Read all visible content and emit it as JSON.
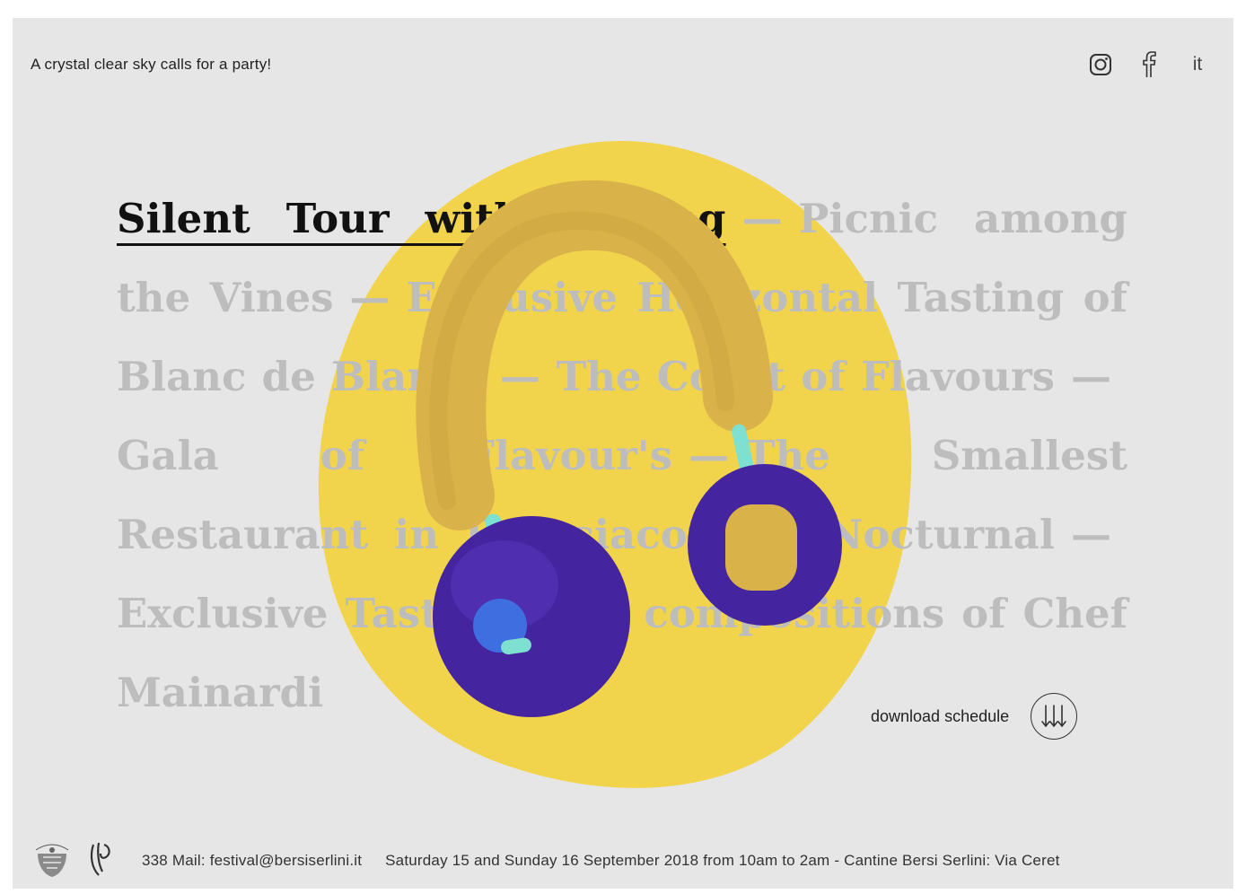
{
  "header": {
    "tagline": "A crystal clear sky calls for a party!",
    "social": [
      {
        "icon": "instagram-icon"
      },
      {
        "icon": "facebook-icon"
      }
    ],
    "language": "it"
  },
  "events": {
    "items": [
      "Silent Tour with Tasting",
      "Picnic among the Vines",
      "Exclusive Horizontal Tasting of Blanc de Blancs",
      "The Court of Flavours",
      "Gala of Flavour's",
      "The Smallest Restaurant in Franciacorta",
      "Nocturnal",
      "Exclusive Tasting with compositions of Chef Mainardi"
    ],
    "active_index": 0,
    "separator": "—"
  },
  "download": {
    "label": "download schedule",
    "icon": "triple-arrow-down-icon"
  },
  "footer": {
    "contact": "338 Mail: festival@bersiserlini.it",
    "dates": "Saturday 15 and Sunday 16 September 2018 from 10am to 2am - Cantine Bersi Serlini: Via Ceret",
    "logos": [
      "bersi-serlini-crest-logo",
      "festival-logo"
    ]
  },
  "colors": {
    "background": "#e6e6e6",
    "blob_yellow": "#f2d44c",
    "headband": "#d9b24a",
    "earcup_purple": "#44259f",
    "stem": "#7ee0d0",
    "inactive_text": "#bdbdbd",
    "active_text": "#111111"
  }
}
